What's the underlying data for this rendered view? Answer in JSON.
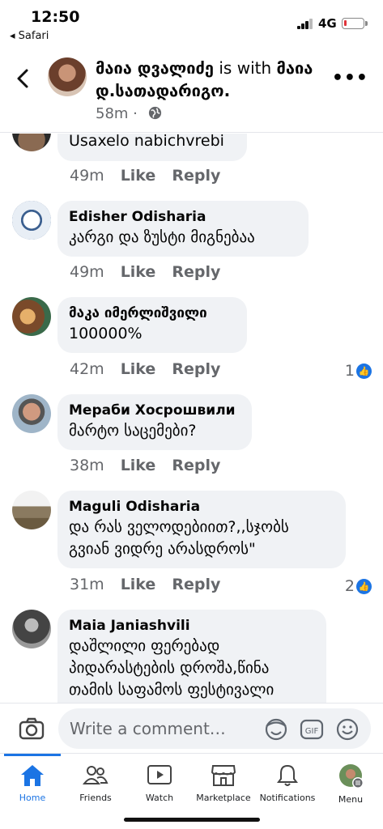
{
  "status_bar": {
    "time": "12:50",
    "back_app": "◂ Safari",
    "network": "4G"
  },
  "header": {
    "author": "მაია დვალიძე",
    "with_text": " is with ",
    "tagged": "მაია დ.სათადარიგო.",
    "time_ago": "58m"
  },
  "comments": [
    {
      "name": "",
      "text": "Usaxelo nabichvrebi",
      "time": "49m",
      "like": "Like",
      "reply": "Reply",
      "reactions": ""
    },
    {
      "name": "Edisher Odisharia",
      "text": "კარგი და ზუსტი მიგნებაა",
      "time": "49m",
      "like": "Like",
      "reply": "Reply",
      "reactions": ""
    },
    {
      "name": "მაკა იმერლიშვილი",
      "text": "100000%",
      "time": "42m",
      "like": "Like",
      "reply": "Reply",
      "reactions": "1"
    },
    {
      "name": "Мераби Хосрошвили",
      "text": "მარტო საცემები?",
      "time": "38m",
      "like": "Like",
      "reply": "Reply",
      "reactions": ""
    },
    {
      "name": "Maguli Odisharia",
      "text": "და რას ველოდებიით?,,სჯობს\nგვიან ვიდრე არასდროს\"",
      "time": "31m",
      "like": "Like",
      "reply": "Reply",
      "reactions": "2"
    },
    {
      "name": "Maia Janiashvili",
      "text": "დაშლილი  ფერებად\nპიდარასტების დროშა,წინა\nთამის საფამოს ფესტივალი",
      "time": "",
      "like": "",
      "reply": "",
      "reactions": ""
    }
  ],
  "composer": {
    "placeholder": "Write a comment…",
    "gif": "GIF"
  },
  "tabs": [
    {
      "label": "Home",
      "icon": "home-icon",
      "active": true
    },
    {
      "label": "Friends",
      "icon": "friends-icon"
    },
    {
      "label": "Watch",
      "icon": "watch-icon"
    },
    {
      "label": "Marketplace",
      "icon": "marketplace-icon"
    },
    {
      "label": "Notifications",
      "icon": "bell-icon"
    },
    {
      "label": "Menu",
      "icon": "menu-avatar-icon"
    }
  ],
  "colors": {
    "accent": "#1b74e4",
    "bubble": "#f0f2f5",
    "muted": "#65676b"
  }
}
